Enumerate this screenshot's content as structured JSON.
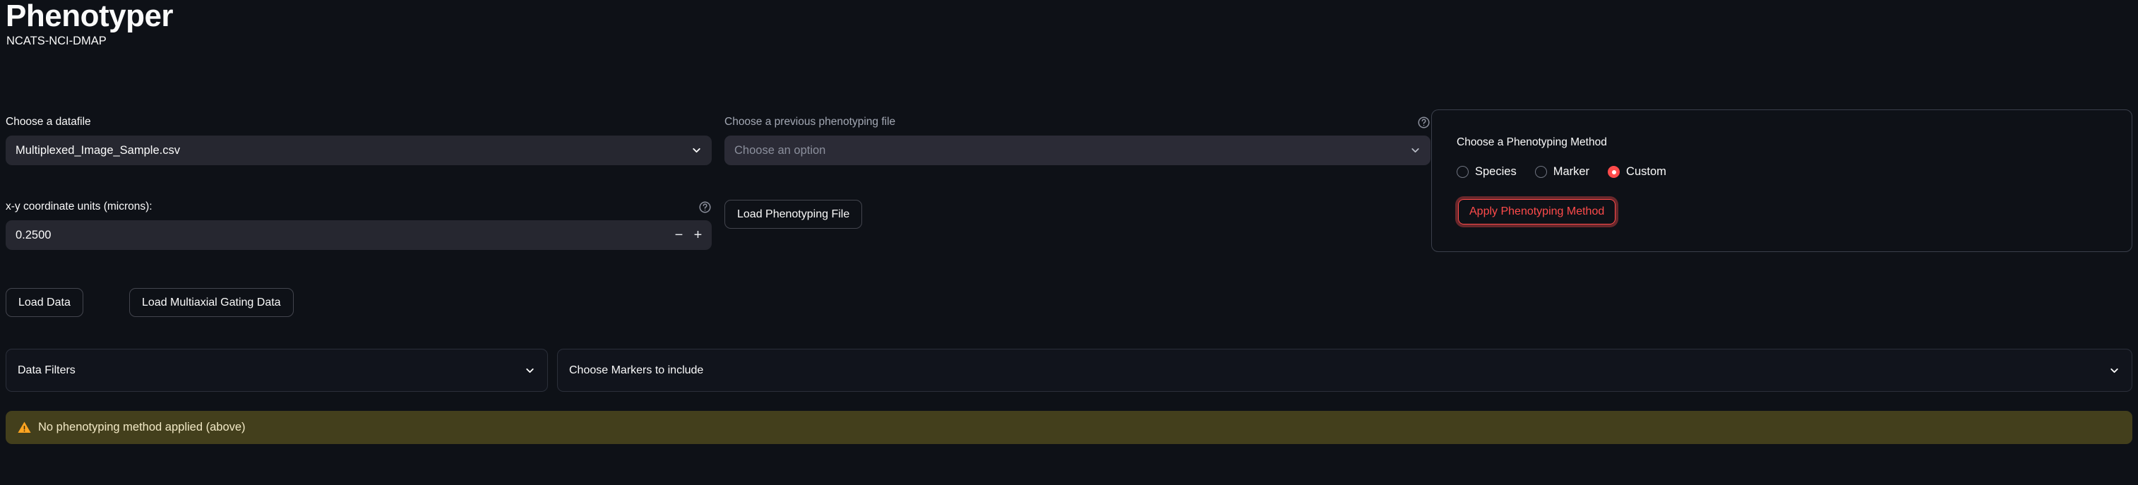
{
  "header": {
    "title": "Phenotyper",
    "subtitle": "NCATS-NCI-DMAP"
  },
  "datafile": {
    "label": "Choose a datafile",
    "selected": "Multiplexed_Image_Sample.csv",
    "chevron_icon": "chevron-down-icon"
  },
  "coordinate_units": {
    "label": "x-y coordinate units (microns):",
    "value": "0.2500",
    "decrement_label": "−",
    "increment_label": "+",
    "help_icon": "help-circle-icon"
  },
  "previous_phenotyping_file": {
    "label": "Choose a previous phenotyping file",
    "placeholder": "Choose an option",
    "selected": "Choose an option",
    "help_icon": "help-circle-icon",
    "chevron_icon": "chevron-down-icon"
  },
  "buttons": {
    "load_phenotyping_file": "Load Phenotyping File",
    "load_data": "Load Data",
    "load_multiaxial_gating_data": "Load Multiaxial Gating Data"
  },
  "phenotyping_method_panel": {
    "title": "Choose a Phenotyping Method",
    "options": [
      {
        "label": "Species",
        "checked": false
      },
      {
        "label": "Marker",
        "checked": false
      },
      {
        "label": "Custom",
        "checked": true
      }
    ],
    "apply_button": "Apply Phenotyping Method",
    "accent_color": "#ff4b4b"
  },
  "expanders": [
    {
      "label": "Data Filters",
      "chevron_icon": "chevron-down-icon",
      "expanded": false
    },
    {
      "label": "Choose Markers to include",
      "chevron_icon": "chevron-down-icon",
      "expanded": false
    }
  ],
  "alert": {
    "icon": "warning-triangle-icon",
    "message": "No phenotyping method applied (above)",
    "background_color": "#433f1c",
    "icon_color": "#ffa421"
  }
}
